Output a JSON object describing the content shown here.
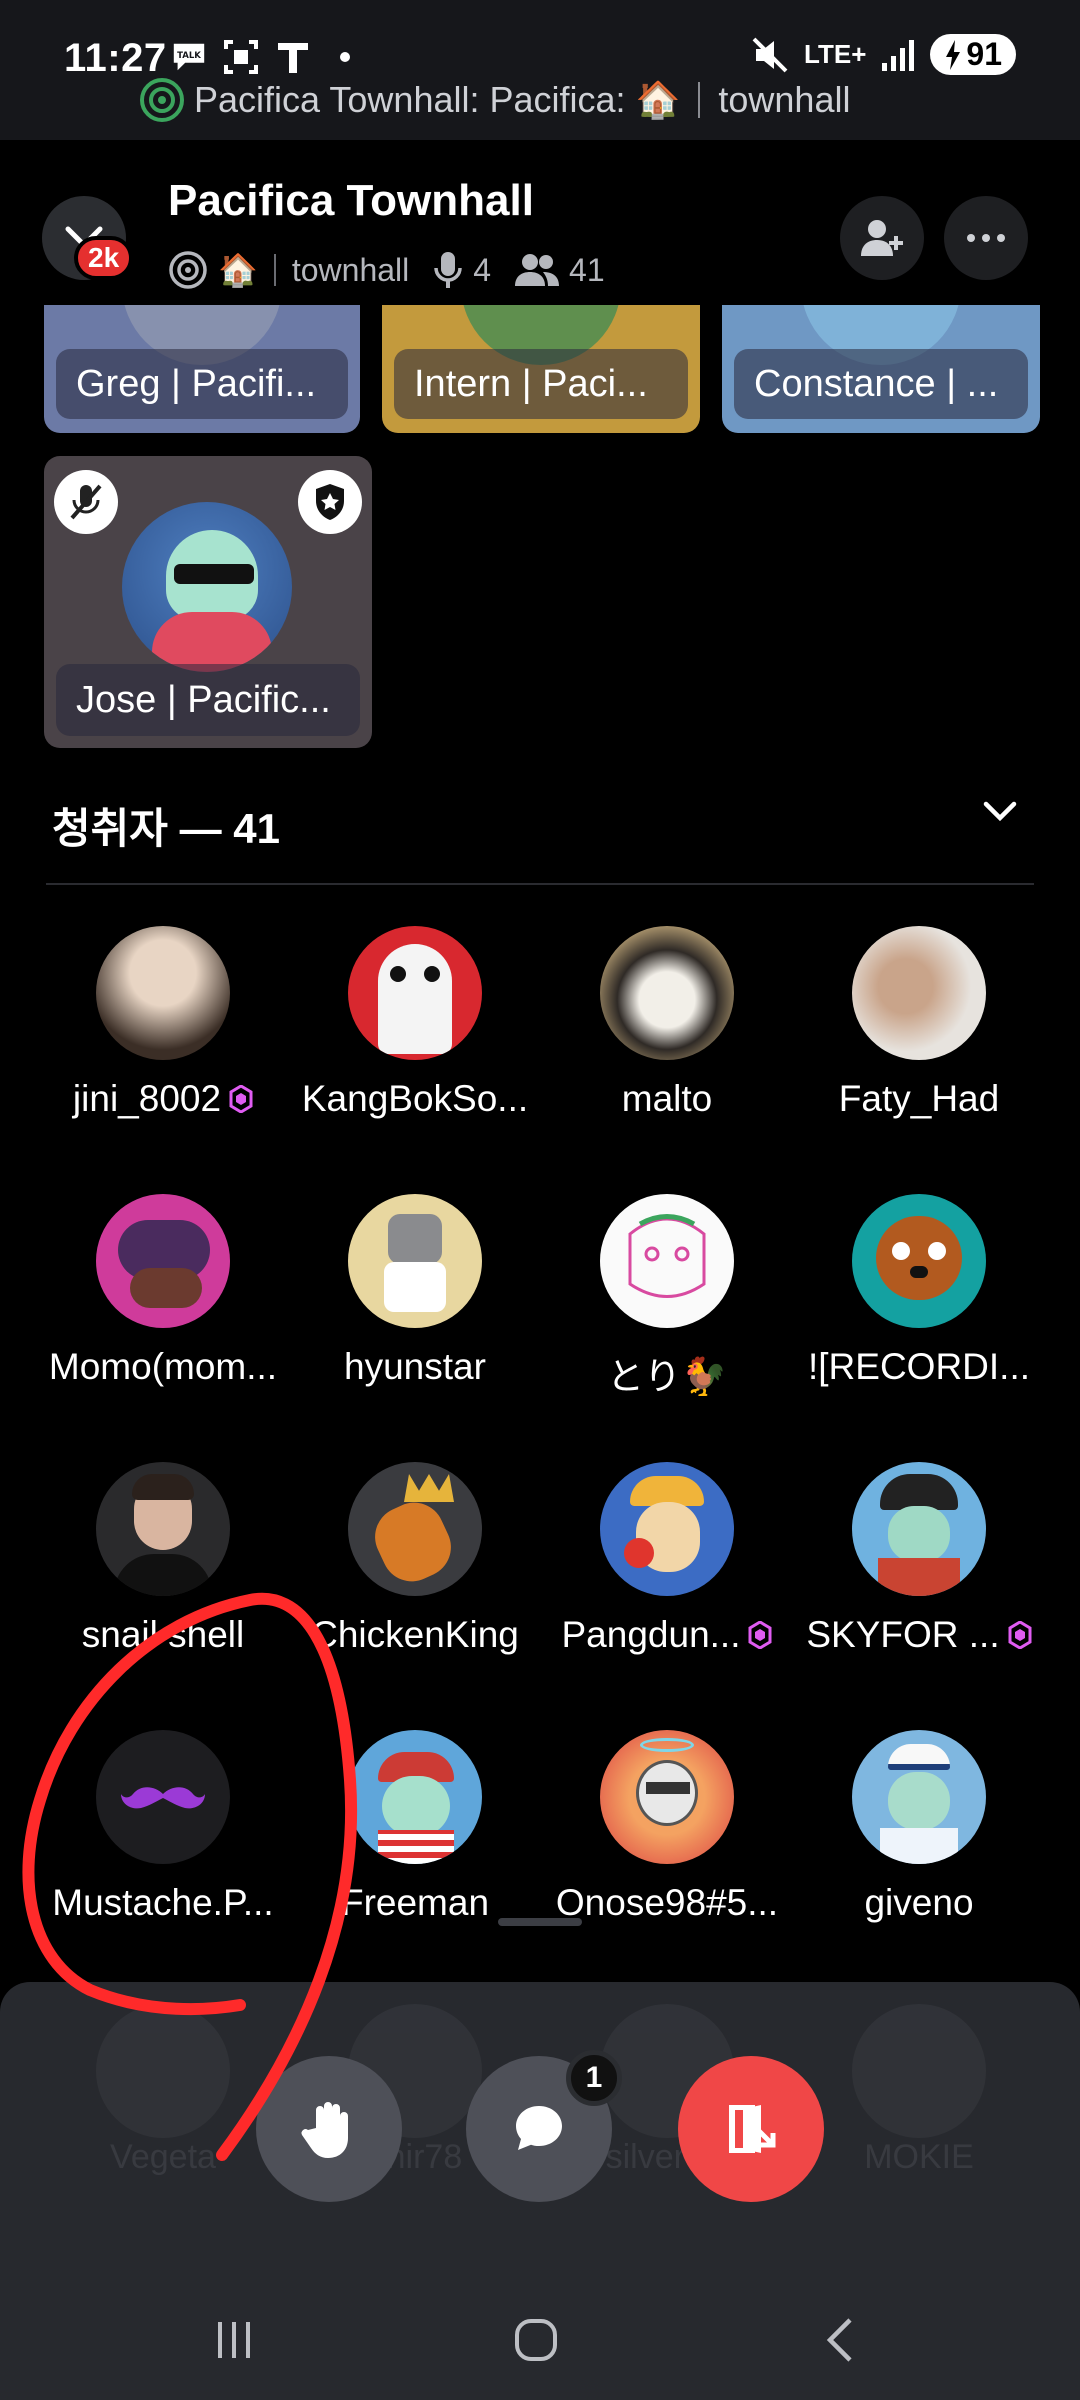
{
  "status_bar": {
    "time": "11:27",
    "left_icons": [
      "talk-icon",
      "screenshot-icon",
      "t-icon",
      "dot-icon"
    ],
    "lte": "LTE+",
    "battery": "91",
    "call_text": "Pacifica Townhall: Pacifica: 🏠",
    "call_channel": "townhall"
  },
  "header": {
    "title": "Pacifica Townhall",
    "badge": "2k",
    "house_emoji": "🏠",
    "channel": "townhall",
    "speakers_count": "4",
    "members_count": "41"
  },
  "speakers": [
    {
      "name": "Greg | Pacifi..."
    },
    {
      "name": "Intern | Paci..."
    },
    {
      "name": "Constance | ..."
    },
    {
      "name": "Jose | Pacific..."
    }
  ],
  "listeners_section": {
    "title": "청취자 — 41"
  },
  "listeners": [
    {
      "name": "jini_8002",
      "gem": true
    },
    {
      "name": "KangBokSo...",
      "gem": false
    },
    {
      "name": "malto",
      "gem": false
    },
    {
      "name": "Faty_Had",
      "gem": false
    },
    {
      "name": "Momo(mom...",
      "gem": false
    },
    {
      "name": "hyunstar",
      "gem": false
    },
    {
      "name": "とり🐓",
      "gem": false
    },
    {
      "name": "![RECORDI...",
      "gem": false
    },
    {
      "name": "snail shell",
      "gem": false
    },
    {
      "name": "ChickenKing",
      "gem": false
    },
    {
      "name": "Pangdun...",
      "gem": true
    },
    {
      "name": "SKYFOR ...",
      "gem": true
    },
    {
      "name": "Mustache.P...",
      "gem": false
    },
    {
      "name": "Freeman",
      "gem": false
    },
    {
      "name": "Onose98#5...",
      "gem": false
    },
    {
      "name": "giveno",
      "gem": false
    }
  ],
  "hidden_row": [
    "Vegeta",
    "anir78",
    "silverwa",
    "MOKIE"
  ],
  "controls": {
    "chat_unread": "1"
  },
  "colors": {
    "accent_red": "#f04747",
    "annotation_red": "#ff2a2a",
    "gem_pink": "#e05cf2"
  }
}
